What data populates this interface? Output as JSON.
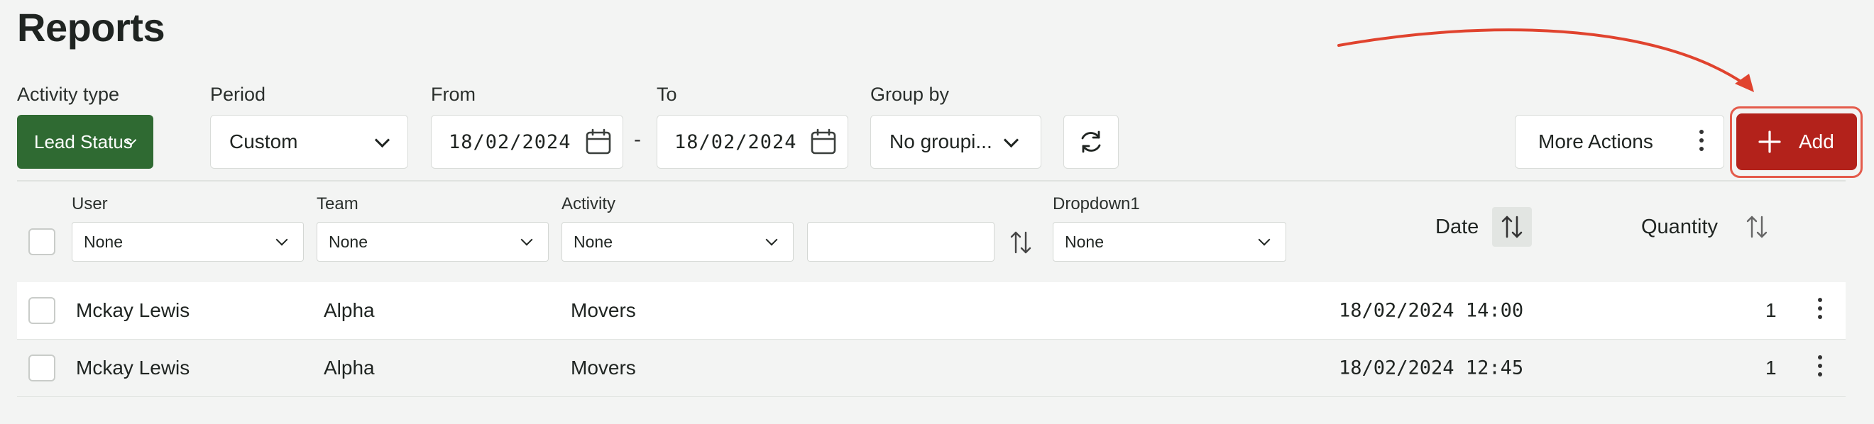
{
  "page": {
    "title": "Reports"
  },
  "filters": {
    "activity_type": {
      "label": "Activity type",
      "value": "Lead Status"
    },
    "period": {
      "label": "Period",
      "value": "Custom"
    },
    "from": {
      "label": "From",
      "value": "18/02/2024"
    },
    "separator": "-",
    "to": {
      "label": "To",
      "value": "18/02/2024"
    },
    "group_by": {
      "label": "Group by",
      "value": "No groupi..."
    }
  },
  "actions": {
    "more_actions": "More Actions",
    "add": "Add",
    "accent": "#b3221b",
    "primary": "#2f6a32"
  },
  "table": {
    "filter_headers": [
      {
        "label": "User",
        "value": "None"
      },
      {
        "label": "Team",
        "value": "None"
      },
      {
        "label": "Activity",
        "value": "None"
      },
      {
        "label": "",
        "value": ""
      },
      {
        "label": "Dropdown1",
        "value": "None"
      }
    ],
    "columns": {
      "date": "Date",
      "quantity": "Quantity"
    },
    "rows": [
      {
        "user": "Mckay Lewis",
        "team": "Alpha",
        "activity": "Movers",
        "date": "18/02/2024 14:00",
        "quantity": "1"
      },
      {
        "user": "Mckay Lewis",
        "team": "Alpha",
        "activity": "Movers",
        "date": "18/02/2024 12:45",
        "quantity": "1"
      }
    ]
  }
}
